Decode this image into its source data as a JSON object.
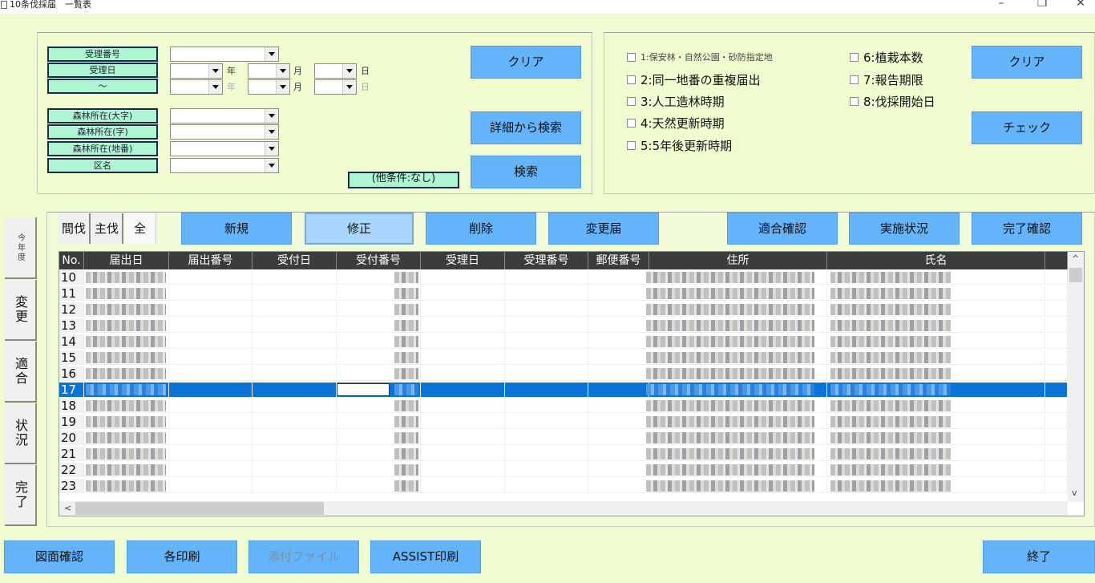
{
  "window": {
    "title": "10条伐採届　一覧表",
    "controls": [
      "minimize",
      "restore",
      "close"
    ]
  },
  "search": {
    "labels": {
      "receipt_no": "受理番号",
      "receipt_date": "受理日",
      "tilde": "～",
      "forest_oaza": "森林所在(大字)",
      "forest_aza": "森林所在(字)",
      "forest_chiban": "森林所在(地番)",
      "district": "区名"
    },
    "units": {
      "year": "年",
      "month": "月",
      "day": "日"
    },
    "receipt_no_value": "",
    "date_from": {
      "year": "",
      "month": "",
      "day": ""
    },
    "date_to": {
      "year": "",
      "month": "",
      "day": ""
    },
    "forest_oaza_value": "",
    "forest_aza_value": "",
    "forest_chiban_value": "",
    "district_value": "",
    "clear_label": "クリア",
    "detail_search_label": "詳細から検索",
    "search_label": "検索",
    "other_conditions": "(他条件:なし)"
  },
  "checks": {
    "items": [
      {
        "label": "1:保安林・自然公園・砂防指定地",
        "checked": false
      },
      {
        "label": "2:同一地番の重複届出",
        "checked": false
      },
      {
        "label": "3:人工造林時期",
        "checked": false
      },
      {
        "label": "4:天然更新時期",
        "checked": false
      },
      {
        "label": "5:5年後更新時期",
        "checked": false
      },
      {
        "label": "6:植栽本数",
        "checked": false
      },
      {
        "label": "7:報告期限",
        "checked": false
      },
      {
        "label": "8:伐採開始日",
        "checked": false
      }
    ],
    "clear_label": "クリア",
    "check_label": "チェック"
  },
  "side_tabs": [
    "今年度",
    "変更",
    "適合",
    "状況",
    "完了"
  ],
  "filter_toggles": [
    "間伐",
    "主伐",
    "全"
  ],
  "toolbar": {
    "new_label": "新規",
    "edit_label": "修正",
    "delete_label": "削除",
    "change_label": "変更届",
    "conformity_label": "適合確認",
    "status_label": "実施状況",
    "complete_label": "完了確認"
  },
  "grid": {
    "columns": [
      "No.",
      "届出日",
      "届出番号",
      "受付日",
      "受付番号",
      "受理日",
      "受理番号",
      "郵便番号",
      "住所",
      "氏名"
    ],
    "rows": [
      {
        "no": "10"
      },
      {
        "no": "11"
      },
      {
        "no": "12"
      },
      {
        "no": "13"
      },
      {
        "no": "14"
      },
      {
        "no": "15"
      },
      {
        "no": "16"
      },
      {
        "no": "17",
        "selected": true
      },
      {
        "no": "18"
      },
      {
        "no": "19"
      },
      {
        "no": "20"
      },
      {
        "no": "21"
      },
      {
        "no": "22"
      },
      {
        "no": "23"
      }
    ],
    "redacted_note": "cell contents pixelated"
  },
  "footer": {
    "drawing_label": "図面確認",
    "print_label": "各印刷",
    "attach_label": "添付ファイル",
    "assist_label": "ASSIST印刷",
    "exit_label": "終了"
  }
}
